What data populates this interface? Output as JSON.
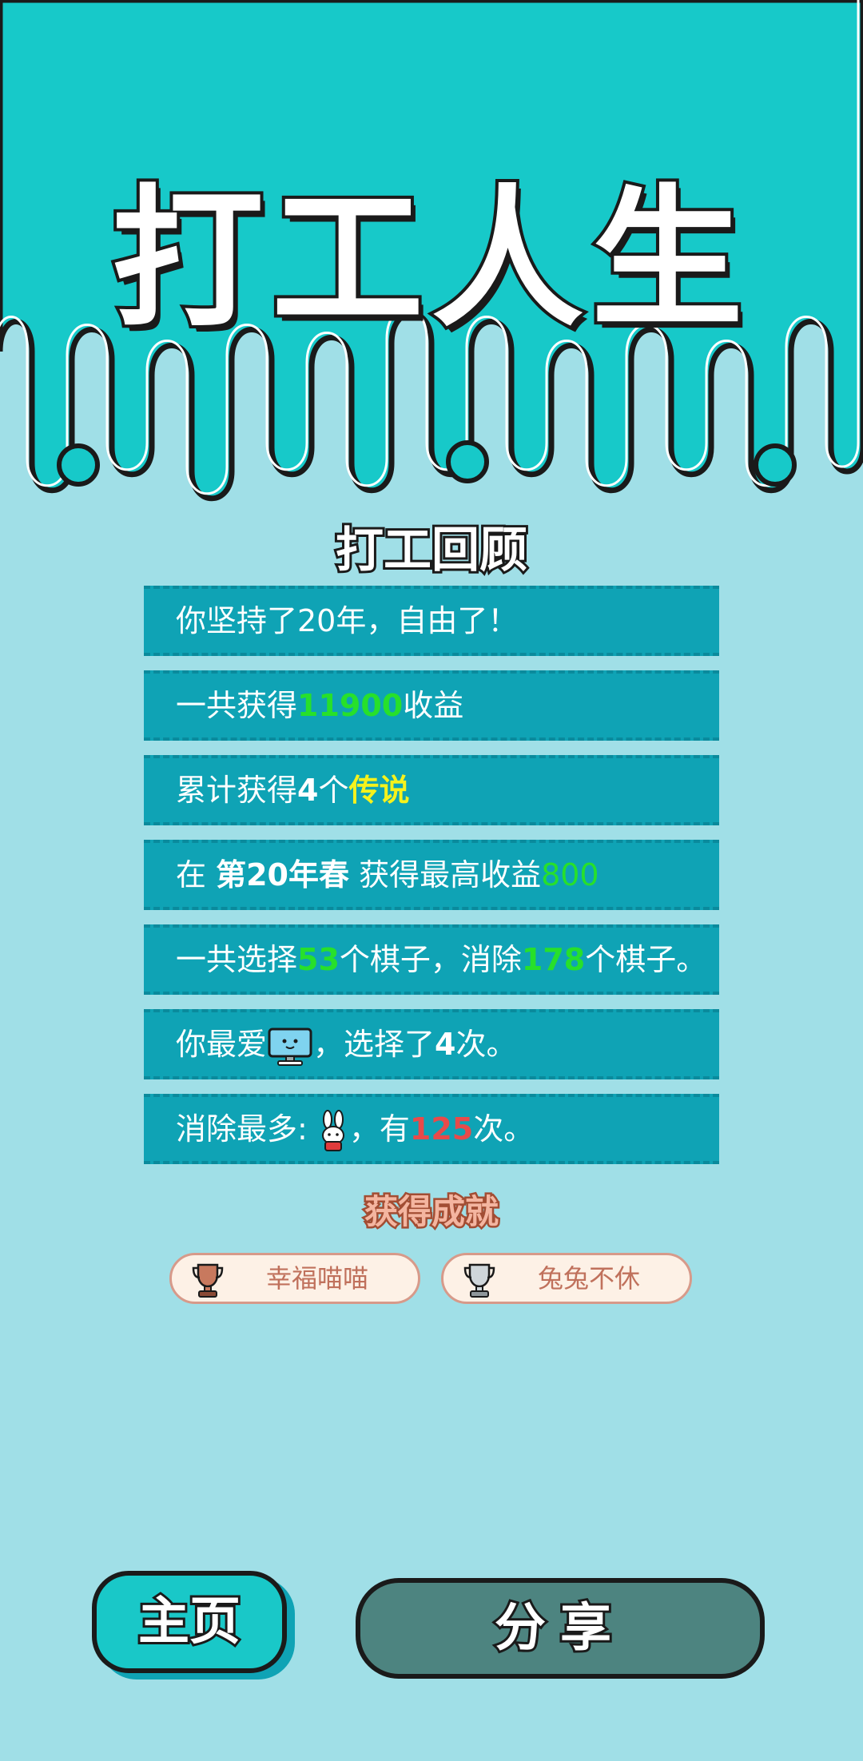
{
  "game": {
    "title": "打工人生"
  },
  "review": {
    "title": "打工回顾",
    "rows": [
      {
        "parts": [
          "你坚持了20年，自由了！"
        ]
      },
      {
        "parts": [
          "一共获得",
          "11900",
          "收益"
        ]
      },
      {
        "parts": [
          "累计获得",
          "4",
          "个",
          "传说"
        ]
      },
      {
        "parts": [
          "在 ",
          "第20年春",
          " 获得最高收益",
          "800"
        ]
      },
      {
        "parts": [
          "一共选择",
          "53",
          "个棋子，消除",
          "178",
          "个棋子。"
        ]
      },
      {
        "parts": [
          "你最爱",
          "，选择了",
          "4",
          "次。"
        ],
        "icon": "computer-monitor-icon"
      },
      {
        "parts": [
          "消除最多: ",
          "，有",
          "125",
          "次。"
        ],
        "icon": "bunny-icon"
      }
    ]
  },
  "achievements": {
    "title": "获得成就",
    "items": [
      {
        "label": "幸福喵喵",
        "icon": "bronze-trophy-icon"
      },
      {
        "label": "兔兔不休",
        "icon": "silver-trophy-icon"
      }
    ]
  },
  "buttons": {
    "home": "主页",
    "share": "分享"
  },
  "colors": {
    "background": "#a0dfe7",
    "top_band": "#17c9c9",
    "row_bg": "#0fa3b5",
    "highlight_green": "#27e02b",
    "highlight_yellow": "#f6f21c",
    "highlight_red": "#e84a4a",
    "share_button": "#4d8480"
  }
}
